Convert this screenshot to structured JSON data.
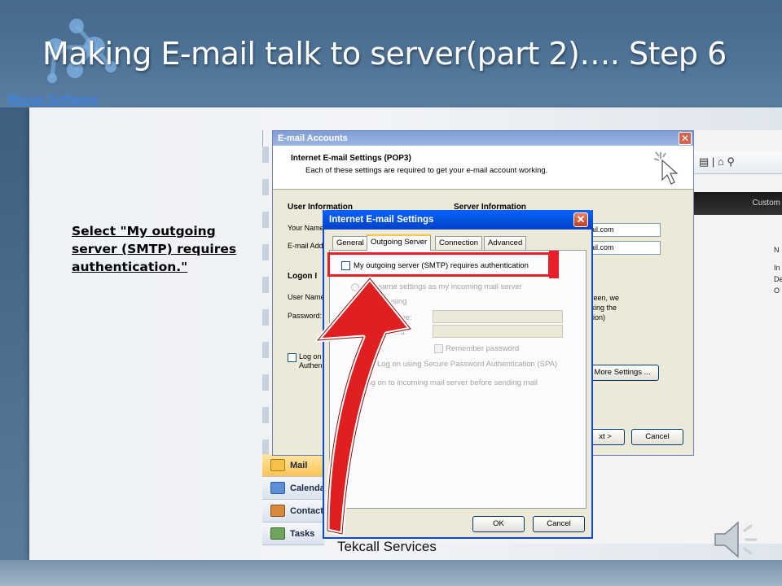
{
  "slide": {
    "title": "Making E-mail talk to server(part  2)…. Step 6",
    "logo_text": "Mouse Software",
    "instruction": "Select \"My outgoing server (SMTP) requires authentication.\"",
    "footer": "Tekcall Services"
  },
  "outlook": {
    "nav_items": [
      "Mail",
      "Calendar",
      "Contacts",
      "Tasks"
    ],
    "dark_band_text": "Custom",
    "right_fragments": [
      "N",
      "In",
      "De",
      "O"
    ]
  },
  "email_accounts": {
    "title": "E-mail Accounts",
    "heading": "Internet E-mail Settings (POP3)",
    "subheading": "Each of these settings are required to get your e-mail account working.",
    "user_info_heading": "User Information",
    "server_info_heading": "Server Information",
    "your_name_label": "Your Name",
    "email_label": "E-mail Add",
    "logon_heading": "Logon I",
    "user_name_label": "User Name",
    "password_label": "Password:",
    "server_field_1": "ail.com",
    "server_field_2": "ail.com",
    "side_text": "creen, we\ncking the\nction)",
    "logon_cb_label": "Log on\nAuthen",
    "more_settings_btn": "More Settings ...",
    "next_btn": "xt >",
    "cancel_btn": "Cancel"
  },
  "internet_settings": {
    "title": "Internet E-mail Settings",
    "tabs": [
      "General",
      "Outgoing Server",
      "Connection",
      "Advanced"
    ],
    "active_tab": "Outgoing Server",
    "smtp_auth_label": "My outgoing server (SMTP) requires authentication",
    "smtp_auth_checked": false,
    "use_same_label": "Use same settings as my incoming mail server",
    "log_on_using_label": "Log on using",
    "user_name_label": "User Name:",
    "password_label": "Password:",
    "remember_password_label": "Remember password",
    "spa_label": "Log on using Secure Password Authentication (SPA)",
    "log_on_incoming_label": "Log on to incoming mail server before sending mail",
    "ok_btn": "OK",
    "cancel_btn": "Cancel"
  },
  "colors": {
    "highlight": "#e8202a",
    "xp_titlebar": "#0353e0",
    "slide_bg": "#4a6f92"
  }
}
